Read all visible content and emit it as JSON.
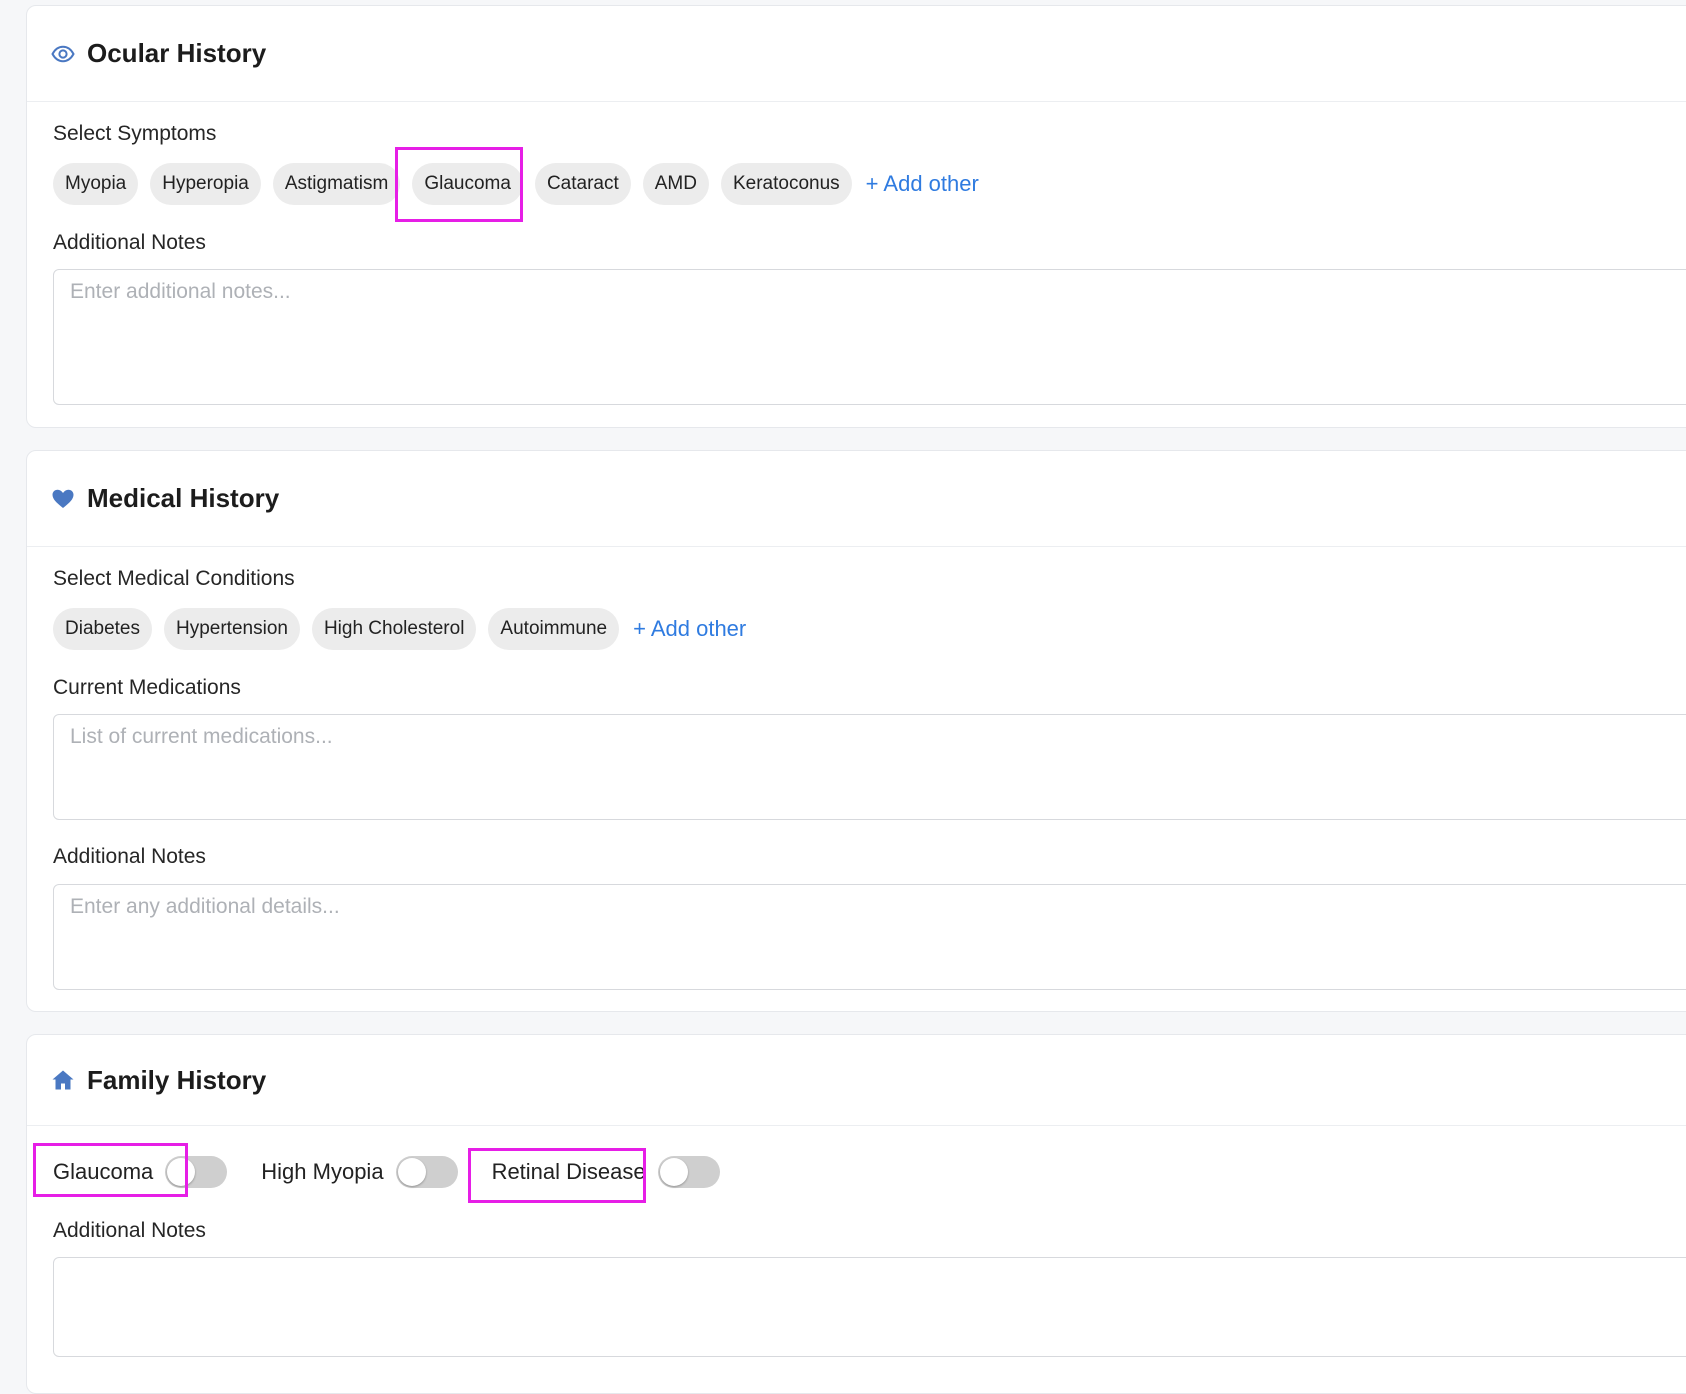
{
  "colors": {
    "accent": "#2f7be0",
    "icon_blue": "#4a78c2",
    "highlight": "#e61ee6",
    "toggle_off": "#cfcfcf"
  },
  "ocular": {
    "title": "Ocular History",
    "icon": "eye-icon",
    "symptoms_label": "Select Symptoms",
    "symptoms": [
      "Myopia",
      "Hyperopia",
      "Astigmatism",
      "Glaucoma",
      "Cataract",
      "AMD",
      "Keratoconus"
    ],
    "add_other": "+ Add other",
    "notes_label": "Additional Notes",
    "notes_placeholder": "Enter additional notes...",
    "notes_value": ""
  },
  "medical": {
    "title": "Medical History",
    "icon": "heart-icon",
    "conditions_label": "Select Medical Conditions",
    "conditions": [
      "Diabetes",
      "Hypertension",
      "High Cholesterol",
      "Autoimmune"
    ],
    "add_other": "+ Add other",
    "medications_label": "Current Medications",
    "medications_placeholder": "List of current medications...",
    "notes_label": "Additional Notes",
    "notes_placeholder": "Enter any additional details..."
  },
  "family": {
    "title": "Family History",
    "icon": "home-icon",
    "toggles": [
      {
        "label": "Glaucoma",
        "on": false
      },
      {
        "label": "High Myopia",
        "on": false
      },
      {
        "label": "Retinal Disease",
        "on": false
      }
    ],
    "notes_label": "Additional Notes"
  }
}
